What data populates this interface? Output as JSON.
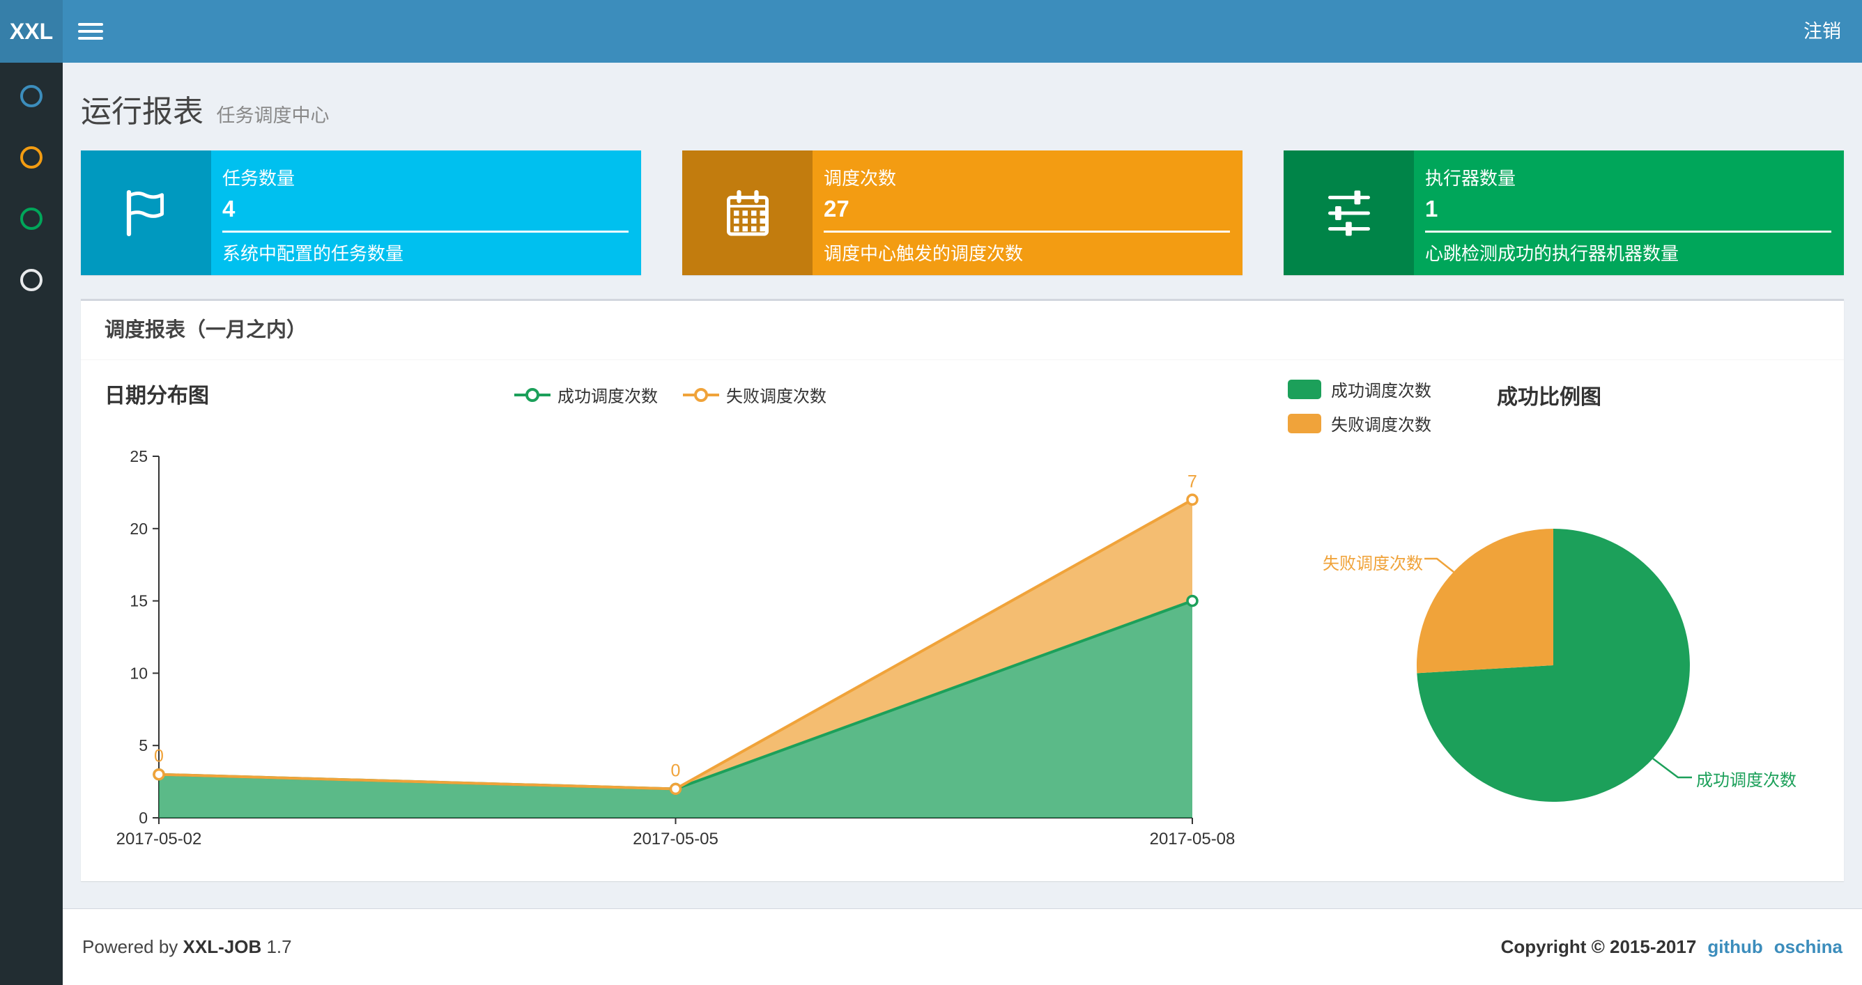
{
  "navbar": {
    "logo": "XXL",
    "logout": "注销"
  },
  "sidebar": {
    "items": [
      {
        "name": "menu-item-1",
        "color": "#3c8dbc"
      },
      {
        "name": "menu-item-2",
        "color": "#f39c12"
      },
      {
        "name": "menu-item-3",
        "color": "#00a65a"
      },
      {
        "name": "menu-item-4",
        "color": "#ffffff"
      }
    ]
  },
  "page": {
    "title": "运行报表",
    "subtitle": "任务调度中心"
  },
  "info_boxes": [
    {
      "label": "任务数量",
      "value": "4",
      "desc": "系统中配置的任务数量",
      "bg": "#00c0ef",
      "icon": "flag-icon"
    },
    {
      "label": "调度次数",
      "value": "27",
      "desc": "调度中心触发的调度次数",
      "bg": "#f39c12",
      "icon": "calendar-icon"
    },
    {
      "label": "执行器数量",
      "value": "1",
      "desc": "心跳检测成功的执行器机器数量",
      "bg": "#00a65a",
      "icon": "sliders-icon"
    }
  ],
  "panel": {
    "title": "调度报表（一月之内）"
  },
  "chart_data": [
    {
      "type": "area",
      "title": "日期分布图",
      "categories": [
        "2017-05-02",
        "2017-05-05",
        "2017-05-08"
      ],
      "series": [
        {
          "name": "成功调度次数",
          "values": [
            3,
            2,
            15
          ],
          "color": "#1ca05a"
        },
        {
          "name": "失败调度次数",
          "values": [
            0,
            0,
            7
          ],
          "color": "#f0a33a"
        }
      ],
      "stacked": true,
      "ylim": [
        0,
        25
      ],
      "yticks": [
        0,
        5,
        10,
        15,
        20,
        25
      ],
      "legend_position": "top",
      "grid": false,
      "point_labels_series": "失败调度次数"
    },
    {
      "type": "pie",
      "title": "成功比例图",
      "slices": [
        {
          "name": "成功调度次数",
          "value": 20,
          "color": "#1ca05a"
        },
        {
          "name": "失败调度次数",
          "value": 7,
          "color": "#f0a33a"
        }
      ],
      "start_angle": "top",
      "direction": "clockwise",
      "legend_position": "top-left"
    }
  ],
  "footer": {
    "powered_by": "Powered by",
    "product": "XXL-JOB",
    "version": "1.7",
    "copyright": "Copyright © 2015-2017",
    "links": [
      {
        "label": "github"
      },
      {
        "label": "oschina"
      }
    ]
  }
}
